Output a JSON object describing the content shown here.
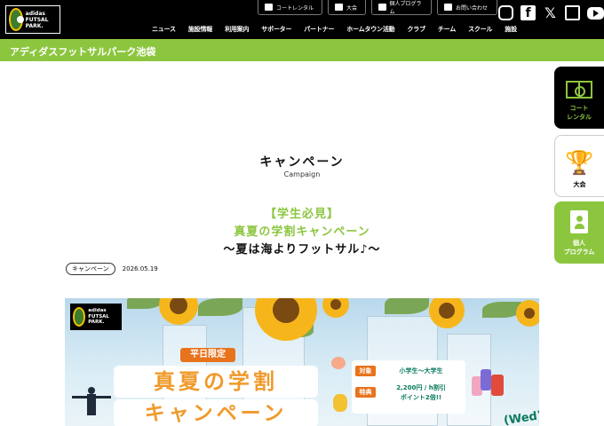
{
  "header": {
    "logo_text": "adidas FUTSAL PARK.",
    "utility": [
      {
        "label": "コートレンタル",
        "icon": "field-icon"
      },
      {
        "label": "大会",
        "icon": "trophy-icon"
      },
      {
        "label": "個人プログラム",
        "icon": "person-icon"
      },
      {
        "label": "お問い合わせ",
        "icon": "mail-icon"
      }
    ],
    "social": [
      "instagram-icon",
      "facebook-icon",
      "x-icon",
      "bookmark-icon",
      "youtube-icon"
    ],
    "nav": [
      "ニュース",
      "施設情報",
      "利用案内",
      "サポーター",
      "パートナー",
      "ホームタウン活動",
      "クラブ",
      "チーム",
      "スクール",
      "施設"
    ]
  },
  "site": {
    "name": "アディダスフットサルパーク池袋"
  },
  "side_tabs": {
    "court": "コート\nレンタル",
    "cup": "大会",
    "program": "個人\nプログラム"
  },
  "page": {
    "title": "キャンペーン",
    "subtitle": "Campaign"
  },
  "article": {
    "line1": "【学生必見】",
    "line2": "真夏の学割キャンペーン",
    "line3": "〜夏は海よりフットサル♪〜",
    "category": "キャンペーン",
    "date": "2026.05.19"
  },
  "banner": {
    "logo_text": "adidas FUTSAL PARK.",
    "tag": "平日限定",
    "title": "真夏の学割",
    "title2": "キャンペーン",
    "target_label": "対象",
    "target_value": "小学生〜大学生",
    "perk_label": "特典",
    "perk_value_1": "2,200円 / h割引",
    "perk_value_2": "ポイント2倍!!",
    "wed": "(Wed)"
  },
  "colors": {
    "brand_green": "#8cc63f",
    "header_bg": "#000000",
    "banner_orange": "#e8731c",
    "banner_title": "#f09a2b"
  }
}
